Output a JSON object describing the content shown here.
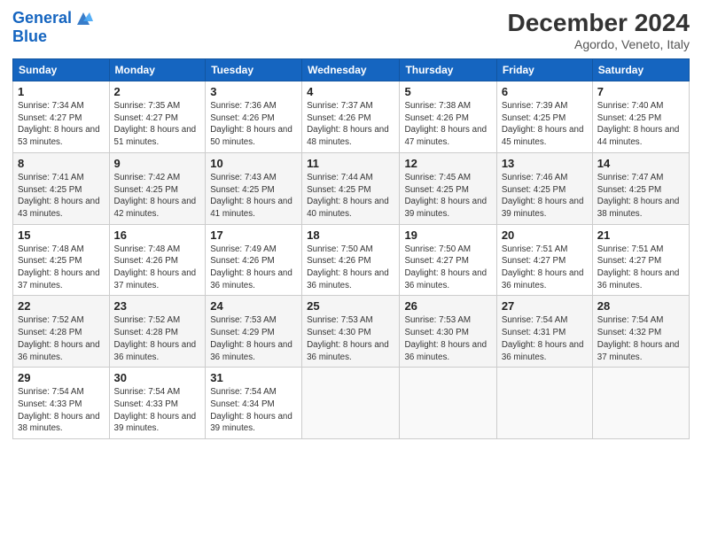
{
  "header": {
    "logo_line1": "General",
    "logo_line2": "Blue",
    "month": "December 2024",
    "location": "Agordo, Veneto, Italy"
  },
  "weekdays": [
    "Sunday",
    "Monday",
    "Tuesday",
    "Wednesday",
    "Thursday",
    "Friday",
    "Saturday"
  ],
  "weeks": [
    [
      {
        "day": "1",
        "sunrise": "Sunrise: 7:34 AM",
        "sunset": "Sunset: 4:27 PM",
        "daylight": "Daylight: 8 hours and 53 minutes."
      },
      {
        "day": "2",
        "sunrise": "Sunrise: 7:35 AM",
        "sunset": "Sunset: 4:27 PM",
        "daylight": "Daylight: 8 hours and 51 minutes."
      },
      {
        "day": "3",
        "sunrise": "Sunrise: 7:36 AM",
        "sunset": "Sunset: 4:26 PM",
        "daylight": "Daylight: 8 hours and 50 minutes."
      },
      {
        "day": "4",
        "sunrise": "Sunrise: 7:37 AM",
        "sunset": "Sunset: 4:26 PM",
        "daylight": "Daylight: 8 hours and 48 minutes."
      },
      {
        "day": "5",
        "sunrise": "Sunrise: 7:38 AM",
        "sunset": "Sunset: 4:26 PM",
        "daylight": "Daylight: 8 hours and 47 minutes."
      },
      {
        "day": "6",
        "sunrise": "Sunrise: 7:39 AM",
        "sunset": "Sunset: 4:25 PM",
        "daylight": "Daylight: 8 hours and 45 minutes."
      },
      {
        "day": "7",
        "sunrise": "Sunrise: 7:40 AM",
        "sunset": "Sunset: 4:25 PM",
        "daylight": "Daylight: 8 hours and 44 minutes."
      }
    ],
    [
      {
        "day": "8",
        "sunrise": "Sunrise: 7:41 AM",
        "sunset": "Sunset: 4:25 PM",
        "daylight": "Daylight: 8 hours and 43 minutes."
      },
      {
        "day": "9",
        "sunrise": "Sunrise: 7:42 AM",
        "sunset": "Sunset: 4:25 PM",
        "daylight": "Daylight: 8 hours and 42 minutes."
      },
      {
        "day": "10",
        "sunrise": "Sunrise: 7:43 AM",
        "sunset": "Sunset: 4:25 PM",
        "daylight": "Daylight: 8 hours and 41 minutes."
      },
      {
        "day": "11",
        "sunrise": "Sunrise: 7:44 AM",
        "sunset": "Sunset: 4:25 PM",
        "daylight": "Daylight: 8 hours and 40 minutes."
      },
      {
        "day": "12",
        "sunrise": "Sunrise: 7:45 AM",
        "sunset": "Sunset: 4:25 PM",
        "daylight": "Daylight: 8 hours and 39 minutes."
      },
      {
        "day": "13",
        "sunrise": "Sunrise: 7:46 AM",
        "sunset": "Sunset: 4:25 PM",
        "daylight": "Daylight: 8 hours and 39 minutes."
      },
      {
        "day": "14",
        "sunrise": "Sunrise: 7:47 AM",
        "sunset": "Sunset: 4:25 PM",
        "daylight": "Daylight: 8 hours and 38 minutes."
      }
    ],
    [
      {
        "day": "15",
        "sunrise": "Sunrise: 7:48 AM",
        "sunset": "Sunset: 4:25 PM",
        "daylight": "Daylight: 8 hours and 37 minutes."
      },
      {
        "day": "16",
        "sunrise": "Sunrise: 7:48 AM",
        "sunset": "Sunset: 4:26 PM",
        "daylight": "Daylight: 8 hours and 37 minutes."
      },
      {
        "day": "17",
        "sunrise": "Sunrise: 7:49 AM",
        "sunset": "Sunset: 4:26 PM",
        "daylight": "Daylight: 8 hours and 36 minutes."
      },
      {
        "day": "18",
        "sunrise": "Sunrise: 7:50 AM",
        "sunset": "Sunset: 4:26 PM",
        "daylight": "Daylight: 8 hours and 36 minutes."
      },
      {
        "day": "19",
        "sunrise": "Sunrise: 7:50 AM",
        "sunset": "Sunset: 4:27 PM",
        "daylight": "Daylight: 8 hours and 36 minutes."
      },
      {
        "day": "20",
        "sunrise": "Sunrise: 7:51 AM",
        "sunset": "Sunset: 4:27 PM",
        "daylight": "Daylight: 8 hours and 36 minutes."
      },
      {
        "day": "21",
        "sunrise": "Sunrise: 7:51 AM",
        "sunset": "Sunset: 4:27 PM",
        "daylight": "Daylight: 8 hours and 36 minutes."
      }
    ],
    [
      {
        "day": "22",
        "sunrise": "Sunrise: 7:52 AM",
        "sunset": "Sunset: 4:28 PM",
        "daylight": "Daylight: 8 hours and 36 minutes."
      },
      {
        "day": "23",
        "sunrise": "Sunrise: 7:52 AM",
        "sunset": "Sunset: 4:28 PM",
        "daylight": "Daylight: 8 hours and 36 minutes."
      },
      {
        "day": "24",
        "sunrise": "Sunrise: 7:53 AM",
        "sunset": "Sunset: 4:29 PM",
        "daylight": "Daylight: 8 hours and 36 minutes."
      },
      {
        "day": "25",
        "sunrise": "Sunrise: 7:53 AM",
        "sunset": "Sunset: 4:30 PM",
        "daylight": "Daylight: 8 hours and 36 minutes."
      },
      {
        "day": "26",
        "sunrise": "Sunrise: 7:53 AM",
        "sunset": "Sunset: 4:30 PM",
        "daylight": "Daylight: 8 hours and 36 minutes."
      },
      {
        "day": "27",
        "sunrise": "Sunrise: 7:54 AM",
        "sunset": "Sunset: 4:31 PM",
        "daylight": "Daylight: 8 hours and 36 minutes."
      },
      {
        "day": "28",
        "sunrise": "Sunrise: 7:54 AM",
        "sunset": "Sunset: 4:32 PM",
        "daylight": "Daylight: 8 hours and 37 minutes."
      }
    ],
    [
      {
        "day": "29",
        "sunrise": "Sunrise: 7:54 AM",
        "sunset": "Sunset: 4:33 PM",
        "daylight": "Daylight: 8 hours and 38 minutes."
      },
      {
        "day": "30",
        "sunrise": "Sunrise: 7:54 AM",
        "sunset": "Sunset: 4:33 PM",
        "daylight": "Daylight: 8 hours and 39 minutes."
      },
      {
        "day": "31",
        "sunrise": "Sunrise: 7:54 AM",
        "sunset": "Sunset: 4:34 PM",
        "daylight": "Daylight: 8 hours and 39 minutes."
      },
      null,
      null,
      null,
      null
    ]
  ]
}
